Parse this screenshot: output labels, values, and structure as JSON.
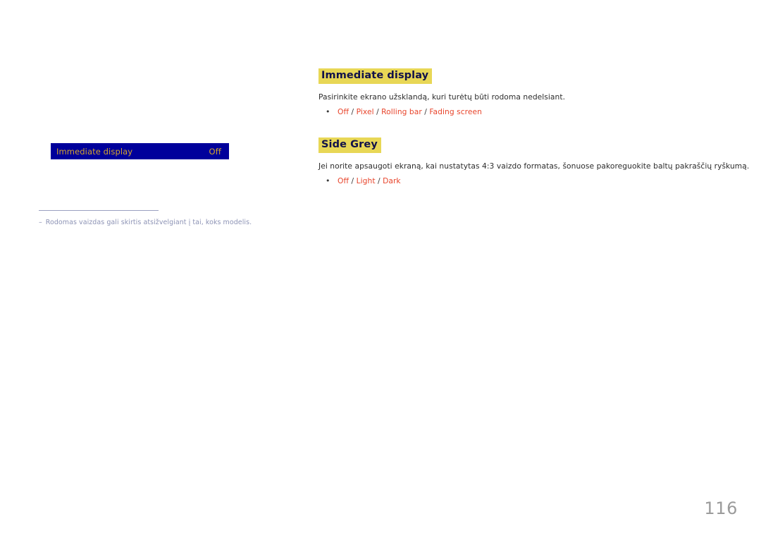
{
  "osd": {
    "label": "Immediate display",
    "value": "Off"
  },
  "footnote": {
    "dash": "–",
    "text": "Rodomas vaizdas gali skirtis atsižvelgiant į tai, koks modelis."
  },
  "sections": [
    {
      "heading": "Immediate display",
      "description": "Pasirinkite ekrano užsklandą, kuri turėtų būti rodoma nedelsiant.",
      "bullet": "•",
      "options": [
        "Off",
        "Pixel",
        "Rolling bar",
        "Fading screen"
      ],
      "separator": " / "
    },
    {
      "heading": "Side Grey",
      "description": "Jei norite apsaugoti ekraną, kai nustatytas 4:3 vaizdo formatas, šonuose pakoreguokite baltų pakraščių ryškumą.",
      "bullet": "•",
      "options": [
        "Off",
        "Light",
        "Dark"
      ],
      "separator": " / "
    }
  ],
  "page": {
    "number": "116"
  },
  "colors": {
    "osd_background": "#00009b",
    "osd_text": "#d3a32e",
    "heading_highlight": "#e8d756",
    "heading_text": "#11114a",
    "option_text": "#e8452c",
    "body_text": "#2c2c2c",
    "footnote_text": "#8d93b5",
    "page_number": "#9b9b9b"
  }
}
